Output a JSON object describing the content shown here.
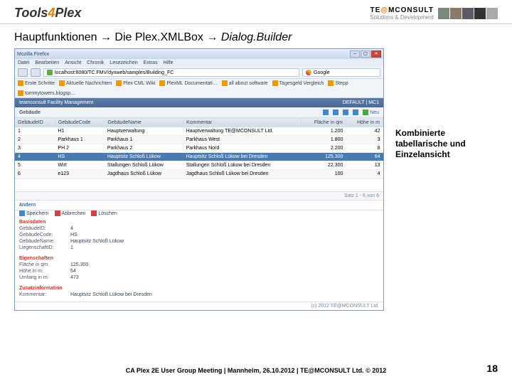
{
  "header": {
    "logo_left_1": "Tools",
    "logo_left_2": "4",
    "logo_left_3": "Plex",
    "logo_right_brand_1": "TE",
    "logo_right_brand_at": "@",
    "logo_right_brand_2": "MCONSULT",
    "logo_right_sub": "Solutions & Development"
  },
  "title": {
    "part1": "Hauptfunktionen ",
    "arrow": "→",
    "part2": " Die Plex.XMLBox ",
    "part3": " Dialog.Builder"
  },
  "window": {
    "title": "Mozilla Firefox",
    "menu": [
      "Datei",
      "Bearbeiten",
      "Ansicht",
      "Chronik",
      "Lesezeichen",
      "Extras",
      "Hilfe"
    ],
    "address": "localhost:8080/TC.FMV/dynweb/samples/Building_FC",
    "search_placeholder": "Google",
    "toolbar2": [
      "Erste Schritte",
      "Aktuelle Nachrichten",
      "Plex CML Wiki",
      "PlexML Documentati…",
      "all about software",
      "Tagesgeld Vergleich",
      "Stepp",
      "tommytowers.blogsp…"
    ]
  },
  "app": {
    "topbar": "teamconsult Facility Management",
    "topbar_right": "DEFAULT | MC1",
    "subbar_label": "Gebäude",
    "actions": {
      "new": "Neu"
    },
    "columns": [
      "GebäudeID",
      "GebäudeCode",
      "GebäudeName",
      "Kommentar",
      "Fläche in qm",
      "Höhe in m"
    ],
    "rows": [
      {
        "id": "1",
        "code": "H1",
        "name": "Hauptverwaltung",
        "comment": "Hauptverwaltung TE@MCONSULT Ltd.",
        "area": "1.200",
        "height": "42"
      },
      {
        "id": "2",
        "code": "Parkhaus 1",
        "name": "Parkhaus 1",
        "comment": "Parkhaus West",
        "area": "1.800",
        "height": "3"
      },
      {
        "id": "3",
        "code": "PH 2",
        "name": "Parkhaus 2",
        "comment": "Parkhaus Nord",
        "area": "2.200",
        "height": "8"
      },
      {
        "id": "4",
        "code": "HS",
        "name": "Hauptsitz Schloß Lükow",
        "comment": "Hauptsitz Schloß Lükow bei Dresden",
        "area": "125.300",
        "height": "64"
      },
      {
        "id": "5",
        "code": "Wirt",
        "name": "Stallungen Schloß Lükow",
        "comment": "Stallungen Schloß Lükow bei Dresden",
        "area": "22.300",
        "height": "13"
      },
      {
        "id": "6",
        "code": "e123",
        "name": "Jagdhaus Schloß Lükow",
        "comment": "Jagdhaus Schloß Lükow bei Dresden",
        "area": "100",
        "height": "4"
      }
    ],
    "selected_row_index": 3,
    "status": "Satz 1 - 6 von 6",
    "edit": {
      "label": "ändern",
      "save": "Speichern",
      "cancel": "Abbrechen",
      "delete": "Löschen"
    },
    "sections": {
      "basis": {
        "title": "Basisdaten",
        "fields": [
          {
            "label": "GebäudeID:",
            "value": "4"
          },
          {
            "label": "GebäudeCode:",
            "value": "HS"
          },
          {
            "label": "GebäudeName:",
            "value": "Hauptsitz Schloß Lükow"
          },
          {
            "label": "LiegenschaftID:",
            "value": "1"
          }
        ]
      },
      "eigen": {
        "title": "Eigenschaften",
        "fields": [
          {
            "label": "Fläche in qm:",
            "value": "125.300"
          },
          {
            "label": "Höhe in m:",
            "value": "64"
          },
          {
            "label": "Umfang in m:",
            "value": "473"
          }
        ]
      },
      "zusatz": {
        "title": "Zusatzinformation",
        "fields": [
          {
            "label": "Kommentar:",
            "value": "Hauptsitz Schloß Lükow bei Dresden"
          }
        ]
      }
    },
    "footer": "(c) 2012 TE@MCONSULT Ltd."
  },
  "callout": "Kombinierte tabellarische und Einzelansicht",
  "footer": "CA Plex 2E User Group Meeting | Mannheim, 26.10.2012 | TE@MCONSULT Ltd. © 2012",
  "page": "18"
}
